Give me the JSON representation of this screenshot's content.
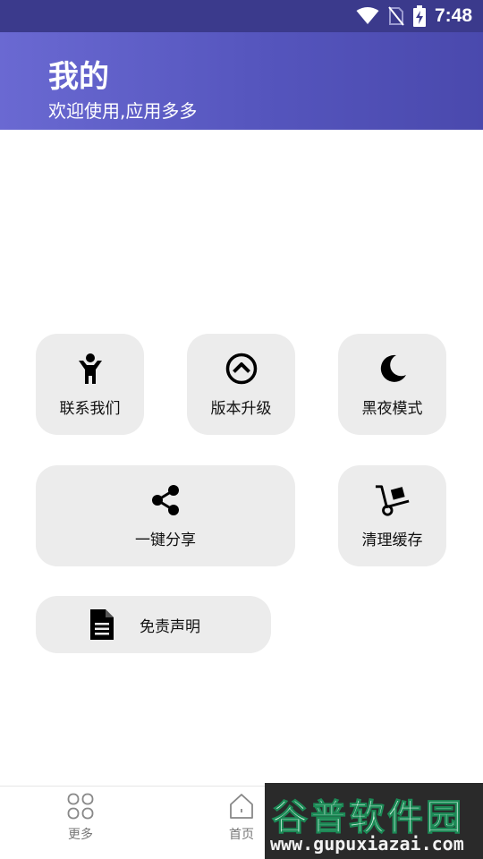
{
  "status_bar": {
    "time": "7:48"
  },
  "header": {
    "title": "我的",
    "subtitle": "欢迎使用,应用多多"
  },
  "menu": [
    {
      "label": "联系我们",
      "icon": "person-icon"
    },
    {
      "label": "版本升级",
      "icon": "arrow-up-circle-icon"
    },
    {
      "label": "黑夜模式",
      "icon": "moon-icon"
    },
    {
      "label": "一键分享",
      "icon": "share-icon"
    },
    {
      "label": "清理缓存",
      "icon": "hand-truck-icon"
    },
    {
      "label": "免责声明",
      "icon": "document-icon"
    }
  ],
  "bottom_nav": [
    {
      "label": "更多",
      "icon": "grid-icon"
    },
    {
      "label": "首页",
      "icon": "home-icon"
    }
  ],
  "watermark": {
    "text": "谷普软件园",
    "url": "www.gupuxiazai.com"
  }
}
